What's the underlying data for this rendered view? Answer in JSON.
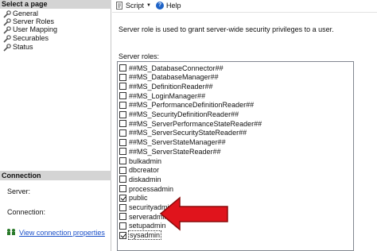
{
  "left_pane": {
    "select_page_header": "Select a page",
    "pages": [
      {
        "label": "General"
      },
      {
        "label": "Server Roles"
      },
      {
        "label": "User Mapping"
      },
      {
        "label": "Securables"
      },
      {
        "label": "Status"
      }
    ],
    "connection_header": "Connection",
    "server_label": "Server:",
    "connection_label": "Connection:",
    "view_connection_link": "View connection properties"
  },
  "toolbar": {
    "script_label": "Script",
    "help_label": "Help",
    "help_glyph": "?"
  },
  "main": {
    "description": "Server role is used to grant server-wide security privileges to a user.",
    "server_roles_label": "Server roles:",
    "roles": [
      {
        "name": "##MS_DatabaseConnector##",
        "checked": false
      },
      {
        "name": "##MS_DatabaseManager##",
        "checked": false
      },
      {
        "name": "##MS_DefinitionReader##",
        "checked": false
      },
      {
        "name": "##MS_LoginManager##",
        "checked": false
      },
      {
        "name": "##MS_PerformanceDefinitionReader##",
        "checked": false
      },
      {
        "name": "##MS_SecurityDefinitionReader##",
        "checked": false
      },
      {
        "name": "##MS_ServerPerformanceStateReader##",
        "checked": false
      },
      {
        "name": "##MS_ServerSecurityStateReader##",
        "checked": false
      },
      {
        "name": "##MS_ServerStateManager##",
        "checked": false
      },
      {
        "name": "##MS_ServerStateReader##",
        "checked": false
      },
      {
        "name": "bulkadmin",
        "checked": false
      },
      {
        "name": "dbcreator",
        "checked": false
      },
      {
        "name": "diskadmin",
        "checked": false
      },
      {
        "name": "processadmin",
        "checked": false
      },
      {
        "name": "public",
        "checked": true
      },
      {
        "name": "securityadmin",
        "checked": false
      },
      {
        "name": "serveradmin",
        "checked": false
      },
      {
        "name": "setupadmin",
        "checked": false
      },
      {
        "name": "sysadmin",
        "checked": true,
        "selected": true
      }
    ]
  },
  "colors": {
    "arrow": "#e0141c",
    "link": "#1a4fc9",
    "header_bg": "#d4d4d4"
  }
}
